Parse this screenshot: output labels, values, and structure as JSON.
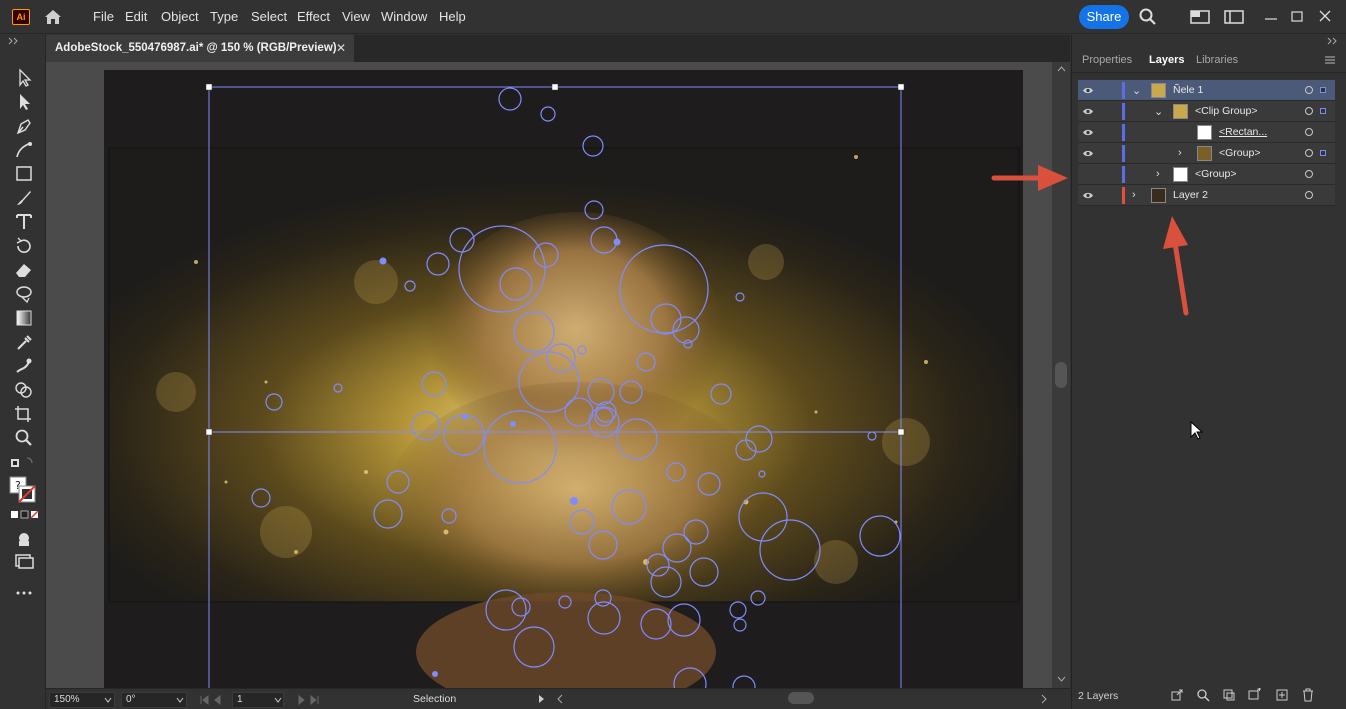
{
  "app": {
    "logo_text": "Ai"
  },
  "menu": {
    "items": [
      "File",
      "Edit",
      "Object",
      "Type",
      "Select",
      "Effect",
      "View",
      "Window",
      "Help"
    ],
    "share_label": "Share"
  },
  "document": {
    "tab_title": "AdobeStock_550476987.ai* @ 150 % (RGB/Preview)",
    "close_glyph": "✕"
  },
  "panel": {
    "tabs": [
      "Properties",
      "Layers",
      "Libraries"
    ],
    "active_tab": "Layers",
    "layers": [
      {
        "name": "Ñele 1",
        "level": 0,
        "expanded": true,
        "visible": true,
        "color": "#5b6ee6",
        "selected": true
      },
      {
        "name": "<Clip Group>",
        "level": 1,
        "expanded": true,
        "visible": true,
        "color": "#5b6ee6"
      },
      {
        "name": "<Rectan...",
        "level": 2,
        "visible": true,
        "color": "#5b6ee6"
      },
      {
        "name": "<Group>",
        "level": 2,
        "expanded": false,
        "visible": true,
        "color": "#5b6ee6"
      },
      {
        "name": "<Group>",
        "level": 1,
        "expanded": false,
        "visible": false,
        "color": "#5b6ee6"
      },
      {
        "name": "Layer 2",
        "level": 0,
        "expanded": false,
        "visible": true,
        "color": "#e0503a"
      }
    ],
    "layer_count": "2 Layers"
  },
  "status": {
    "zoom": "150%",
    "rotation": "0°",
    "artboard": "1",
    "tool": "Selection"
  },
  "colors": {
    "accent": "#1473e6",
    "layer1_color": "#5b6ee6",
    "layer2_color": "#e0503a",
    "annotation_arrow": "#d9503c"
  }
}
